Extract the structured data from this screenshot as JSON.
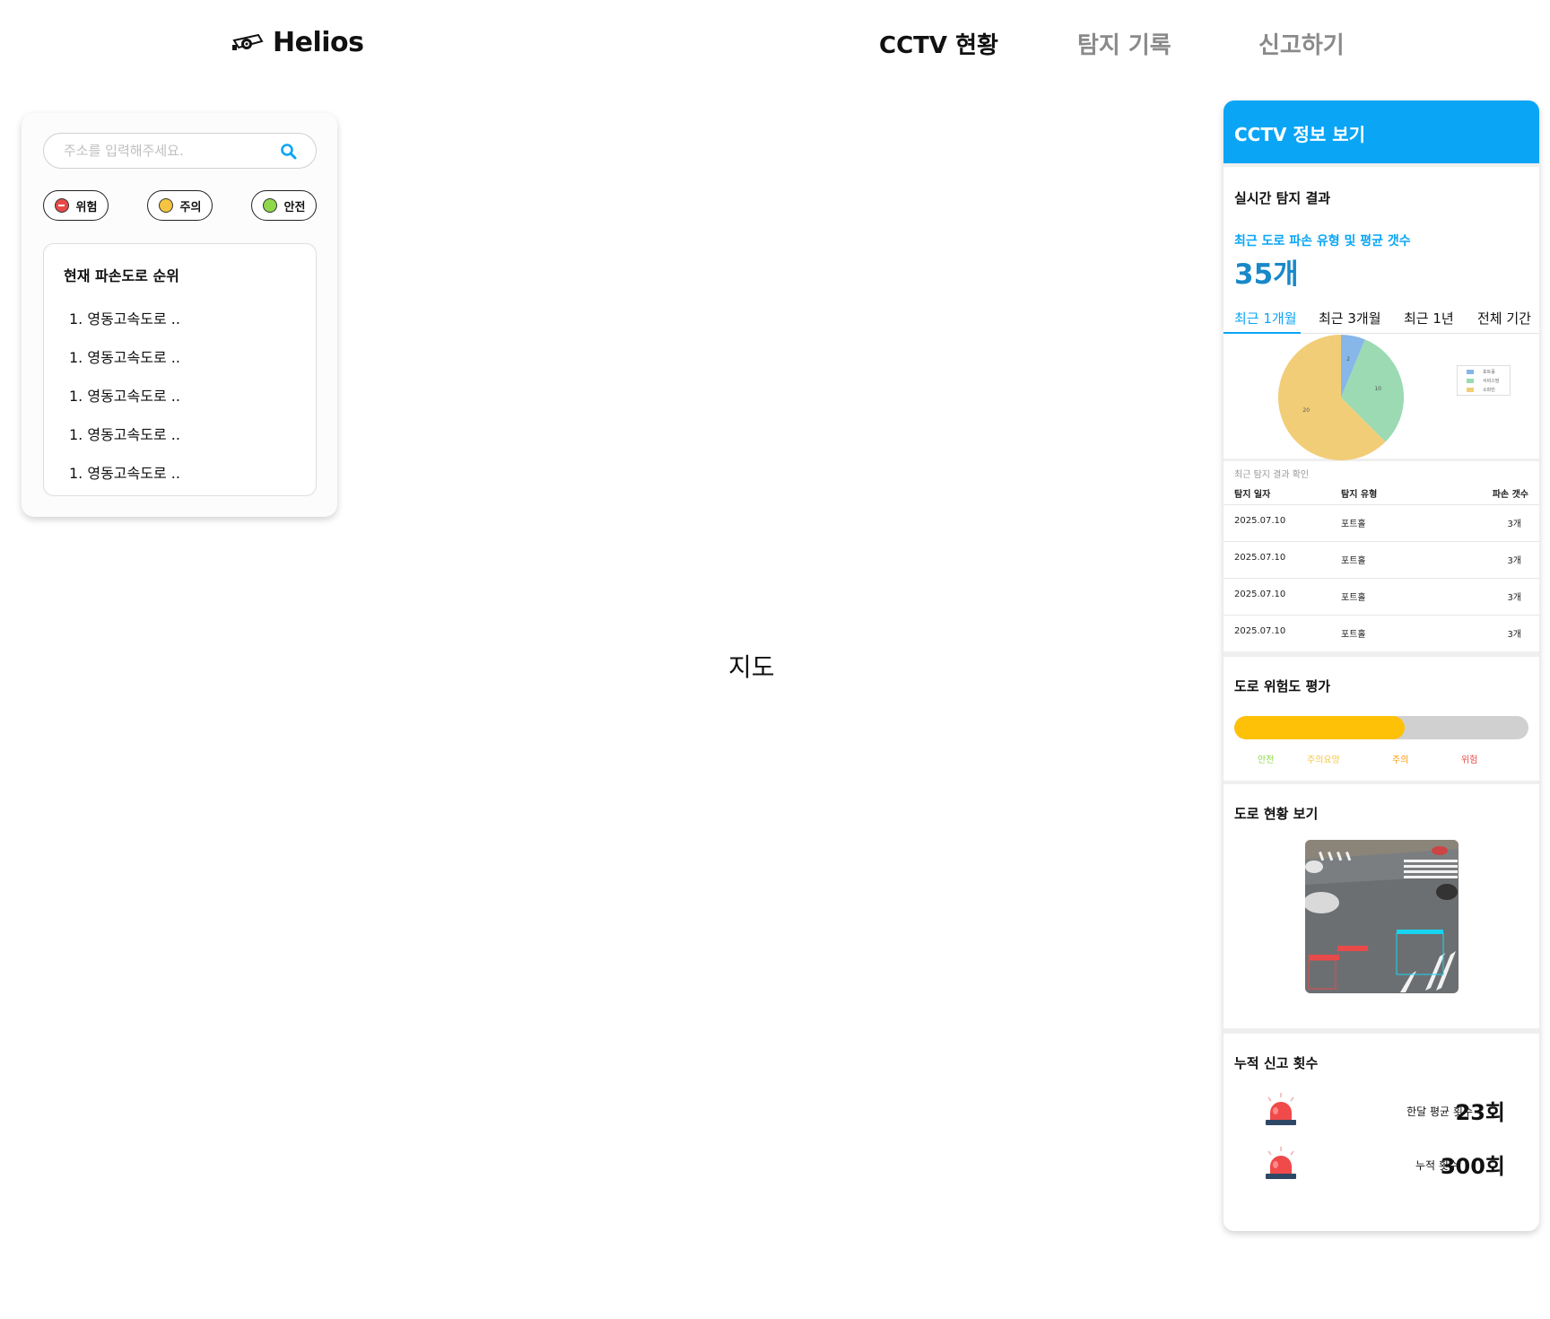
{
  "brand": {
    "name": "Helios",
    "icon": "cctv-camera-icon"
  },
  "nav": {
    "items": [
      {
        "label": "CCTV 현황",
        "active": true
      },
      {
        "label": "탐지 기록",
        "active": false
      },
      {
        "label": "신고하기",
        "active": false
      }
    ]
  },
  "search": {
    "placeholder": "주소를 입력해주세요.",
    "value": "",
    "icon": "search-icon"
  },
  "filters": [
    {
      "label": "위험",
      "color": "#e84a4a"
    },
    {
      "label": "주의",
      "color": "#f5c542"
    },
    {
      "label": "안전",
      "color": "#8fd84a"
    }
  ],
  "ranking": {
    "title": "현재 파손도로 순위",
    "items": [
      "1. 영동고속도로 ..",
      "1. 영동고속도로 ..",
      "1. 영동고속도로 ..",
      "1. 영동고속도로 ..",
      "1. 영동고속도로 .."
    ]
  },
  "map": {
    "label": "지도"
  },
  "panel": {
    "title": "CCTV 정보 보기",
    "accent": "#0aa5f5",
    "realtime": {
      "title": "실시간 탐지 결과",
      "subtitle": "최근 도로 파손 유형 및 평균 갯수",
      "count": "35개",
      "tabs": [
        "최근 1개월",
        "최근 3개월",
        "최근 1년",
        "전체 기간"
      ],
      "active_tab": 0
    },
    "chart_data": {
      "type": "pie",
      "labels": [
        "포트홀",
        "서비스빔",
        "소파빈"
      ],
      "values": [
        2,
        10,
        20
      ],
      "colors": [
        "#87b6e8",
        "#9bdab2",
        "#f2cd77"
      ],
      "legend": "right"
    },
    "records": {
      "caption": "최근 탐지 결과 확인",
      "headers": [
        "탐지 일자",
        "탐지 유형",
        "파손 갯수"
      ],
      "rows": [
        [
          "2025.07.10",
          "포트홀",
          "3개"
        ],
        [
          "2025.07.10",
          "포트홀",
          "3개"
        ],
        [
          "2025.07.10",
          "포트홀",
          "3개"
        ],
        [
          "2025.07.10",
          "포트홀",
          "3개"
        ]
      ]
    },
    "risk": {
      "title": "도로 위험도 평가",
      "level_percent": 58,
      "fill_color": "#ffc107",
      "labels": [
        {
          "text": "안전",
          "color": "#8fd84a"
        },
        {
          "text": "주의요망",
          "color": "#f5c542"
        },
        {
          "text": "주의",
          "color": "#ff9800"
        },
        {
          "text": "위험",
          "color": "#e84a4a"
        }
      ]
    },
    "road": {
      "title": "도로 현황 보기"
    },
    "reports": {
      "title": "누적 신고 횟수",
      "items": [
        {
          "label": "한달 평균 횟수",
          "value": "23회",
          "icon": "siren-icon"
        },
        {
          "label": "누적 횟수",
          "value": "300회",
          "icon": "siren-icon"
        }
      ]
    }
  }
}
